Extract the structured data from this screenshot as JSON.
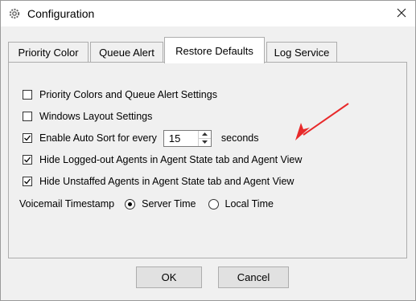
{
  "window": {
    "title": "Configuration",
    "icon": "gear-icon",
    "close_icon": "close-icon"
  },
  "tabs": [
    {
      "label": "Priority Color",
      "active": false
    },
    {
      "label": "Queue Alert",
      "active": false
    },
    {
      "label": "Restore Defaults",
      "active": true
    },
    {
      "label": "Log Service",
      "active": false
    }
  ],
  "options": {
    "priority_colors": {
      "label": "Priority Colors and Queue Alert Settings",
      "checked": false
    },
    "windows_layout": {
      "label": "Windows Layout Settings",
      "checked": false
    },
    "auto_sort": {
      "label": "Enable Auto Sort for every",
      "checked": true,
      "value": "15",
      "unit": "seconds"
    },
    "hide_logged_out": {
      "label": "Hide Logged-out Agents in Agent State tab and Agent View",
      "checked": true
    },
    "hide_unstaffed": {
      "label": "Hide Unstaffed Agents in Agent State tab and Agent View",
      "checked": true
    }
  },
  "voicemail": {
    "label": "Voicemail Timestamp",
    "options": [
      {
        "label": "Server Time",
        "selected": true
      },
      {
        "label": "Local Time",
        "selected": false
      }
    ]
  },
  "buttons": {
    "ok": "OK",
    "cancel": "Cancel"
  },
  "colors": {
    "annotation_arrow": "#e8292a",
    "panel_bg": "#f0f0f0",
    "button_bg": "#e1e1e1"
  }
}
